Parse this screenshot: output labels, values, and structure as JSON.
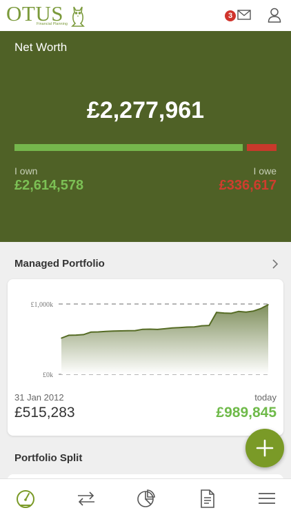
{
  "header": {
    "logo_text": "OTUS",
    "logo_subtext": "Financial Planning",
    "notification_count": "3",
    "icons": [
      "owl-logo-icon",
      "mail-icon",
      "user-icon"
    ]
  },
  "net_worth": {
    "title": "Net Worth",
    "value": "£2,277,961",
    "own_label": "I own",
    "own_value": "£2,614,578",
    "owe_label": "I owe",
    "owe_value": "£336,617",
    "own_share": 0.886,
    "owe_share": 0.114
  },
  "managed_portfolio": {
    "title": "Managed Portfolio",
    "start_date": "31 Jan 2012",
    "start_value": "£515,283",
    "end_label": "today",
    "end_value": "£989,845"
  },
  "chart_data": {
    "type": "area",
    "title": "",
    "ylim": [
      0,
      1000
    ],
    "ytick_labels": [
      "£1,000k",
      "£0k"
    ],
    "series": [
      {
        "values": [
          515,
          555,
          558,
          565,
          600,
          603,
          610,
          615,
          618,
          620,
          622,
          640,
          642,
          638,
          648,
          660,
          665,
          672,
          675,
          690,
          695,
          880,
          872,
          868,
          895,
          885,
          900,
          935,
          990
        ]
      }
    ],
    "colors": {
      "line": "#556b24",
      "fill_top": "#8a9a6a",
      "fill_bottom": "#ffffff"
    },
    "grid": "dashed reference lines at 0 and 1,000k"
  },
  "portfolio_split": {
    "title": "Portfolio Split"
  },
  "fab": {
    "icon": "plus-icon"
  },
  "bottom_nav": {
    "items": [
      {
        "icon": "dashboard-gauge-icon",
        "active": true
      },
      {
        "icon": "transfer-arrows-icon",
        "active": false
      },
      {
        "icon": "pie-chart-icon",
        "active": false
      },
      {
        "icon": "document-icon",
        "active": false
      },
      {
        "icon": "menu-icon",
        "active": false
      }
    ]
  },
  "colors": {
    "brand": "#7b9a3b",
    "panel": "#4f6126",
    "positive": "#75b74c",
    "negative": "#c8392b",
    "badge": "#d0342c"
  }
}
